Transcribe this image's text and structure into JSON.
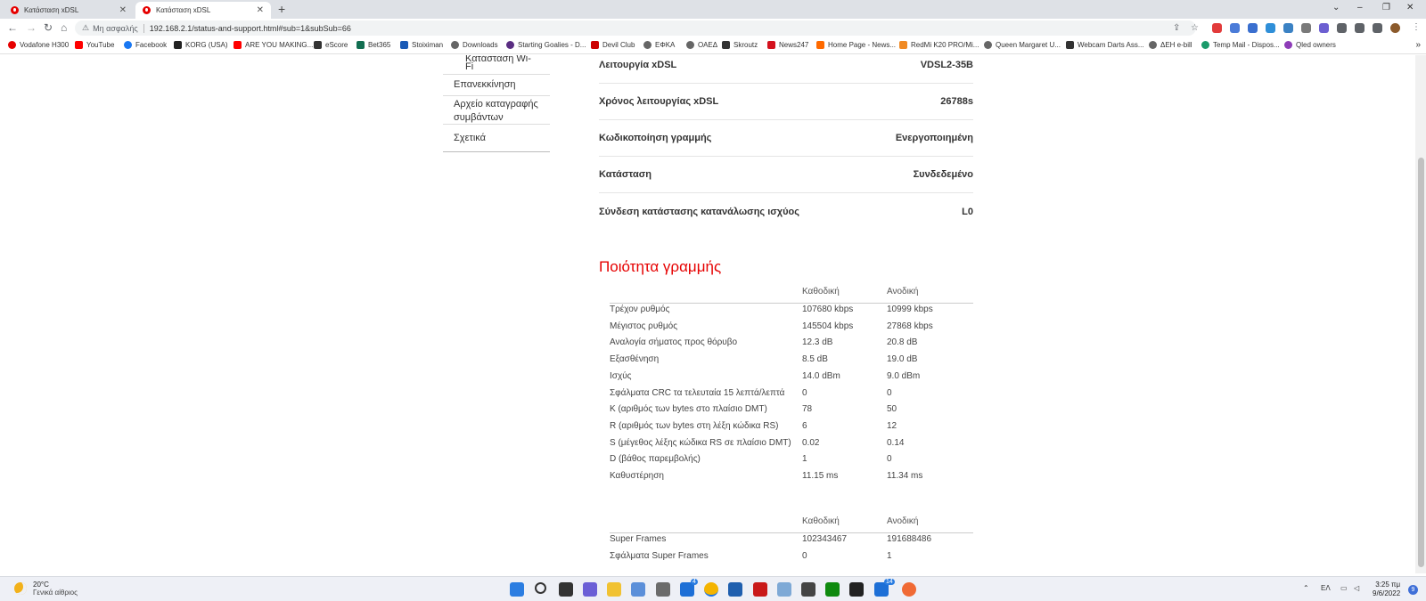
{
  "browser": {
    "tabs": [
      {
        "title": "Κατάσταση xDSL"
      },
      {
        "title": "Κατάσταση xDSL"
      }
    ],
    "address": {
      "security_label": "Μη ασφαλής",
      "url": "192.168.2.1/status-and-support.html#sub=1&subSub=66"
    },
    "bookmarks": [
      {
        "label": "Vodafone H300",
        "color": "#e60000"
      },
      {
        "label": "YouTube",
        "color": "#ff0000"
      },
      {
        "label": "Facebook",
        "color": "#1877f2"
      },
      {
        "label": "KORG (USA)",
        "color": "#222222"
      },
      {
        "label": "ARE YOU MAKING...",
        "color": "#ff0000"
      },
      {
        "label": "eScore",
        "color": "#333333"
      },
      {
        "label": "Bet365",
        "color": "#126e51"
      },
      {
        "label": "Stoiximan",
        "color": "#1a5ab6"
      },
      {
        "label": "Downloads",
        "color": "#666666"
      },
      {
        "label": "Starting Goalies - D...",
        "color": "#5a2d82"
      },
      {
        "label": "Devil Club",
        "color": "#cc0000"
      },
      {
        "label": "ΕΦΚΑ",
        "color": "#666666"
      },
      {
        "label": "ΟΑΕΔ",
        "color": "#666666"
      },
      {
        "label": "Skroutz",
        "color": "#333333"
      },
      {
        "label": "News247",
        "color": "#d4121e"
      },
      {
        "label": "Home Page - News...",
        "color": "#ff6a00"
      },
      {
        "label": "RedMi K20 PRO/Mi...",
        "color": "#f08a24"
      },
      {
        "label": "Queen Margaret U...",
        "color": "#666666"
      },
      {
        "label": "Webcam Darts Ass...",
        "color": "#333333"
      },
      {
        "label": "ΔΕΗ e-bill",
        "color": "#666666"
      },
      {
        "label": "Temp Mail - Dispos...",
        "color": "#1a9a6a"
      },
      {
        "label": "Qled owners",
        "color": "#8e3cb8"
      }
    ]
  },
  "sidebar": {
    "items": [
      {
        "label": "Κατάσταση Wi-Fi"
      },
      {
        "label": "Επανεκκίνηση"
      },
      {
        "label": "Αρχείο καταγραφής συμβάντων"
      },
      {
        "label": "Σχετικά"
      }
    ]
  },
  "status": {
    "rows": [
      {
        "label": "Λειτουργία xDSL",
        "value": "VDSL2-35B"
      },
      {
        "label": "Χρόνος λειτουργίας xDSL",
        "value": "26788s"
      },
      {
        "label": "Κωδικοποίηση γραμμής",
        "value": "Ενεργοποιημένη"
      },
      {
        "label": "Κατάσταση",
        "value": "Συνδεδεμένο"
      },
      {
        "label": "Σύνδεση κατάστασης κατανάλωσης ισχύος",
        "value": "L0"
      }
    ]
  },
  "line_quality": {
    "title": "Ποιότητα γραμμής",
    "headers": {
      "down": "Καθοδική",
      "up": "Ανοδική"
    },
    "rows": [
      {
        "label": "Τρέχον ρυθμός",
        "down": "107680 kbps",
        "up": "10999 kbps"
      },
      {
        "label": "Μέγιστος ρυθμός",
        "down": "145504 kbps",
        "up": "27868 kbps"
      },
      {
        "label": "Αναλογία σήματος προς θόρυβο",
        "down": "12.3 dB",
        "up": "20.8 dB"
      },
      {
        "label": "Εξασθένηση",
        "down": "8.5 dB",
        "up": "19.0 dB"
      },
      {
        "label": "Ισχύς",
        "down": "14.0 dBm",
        "up": "9.0 dBm"
      },
      {
        "label": "Σφάλματα CRC τα τελευταία 15 λεπτά/λεπτά",
        "down": "0",
        "up": "0"
      },
      {
        "label": "K (αριθμός των bytes στο πλαίσιο DMT)",
        "down": "78",
        "up": "50"
      },
      {
        "label": "R (αριθμός των bytes στη λέξη κώδικα RS)",
        "down": "6",
        "up": "12"
      },
      {
        "label": "S (μέγεθος λέξης κώδικα RS σε πλαίσιο DMT)",
        "down": "0.02",
        "up": "0.14"
      },
      {
        "label": "D (βάθος παρεμβολής)",
        "down": "1",
        "up": "0"
      },
      {
        "label": "Καθυστέρηση",
        "down": "11.15 ms",
        "up": "11.34 ms"
      }
    ]
  },
  "frames": {
    "headers": {
      "down": "Καθοδική",
      "up": "Ανοδική"
    },
    "rows": [
      {
        "label": "Super Frames",
        "down": "102343467",
        "up": "191688486"
      },
      {
        "label": "Σφάλματα Super Frames",
        "down": "0",
        "up": "1"
      }
    ]
  },
  "taskbar": {
    "weather_temp": "20°C",
    "weather_desc": "Γενικά αίθριος",
    "language": "ΕΛ",
    "time": "3:25 πμ",
    "date": "9/6/2022",
    "notifications": "9",
    "mail_badge": "4",
    "teams_badge": "14"
  }
}
